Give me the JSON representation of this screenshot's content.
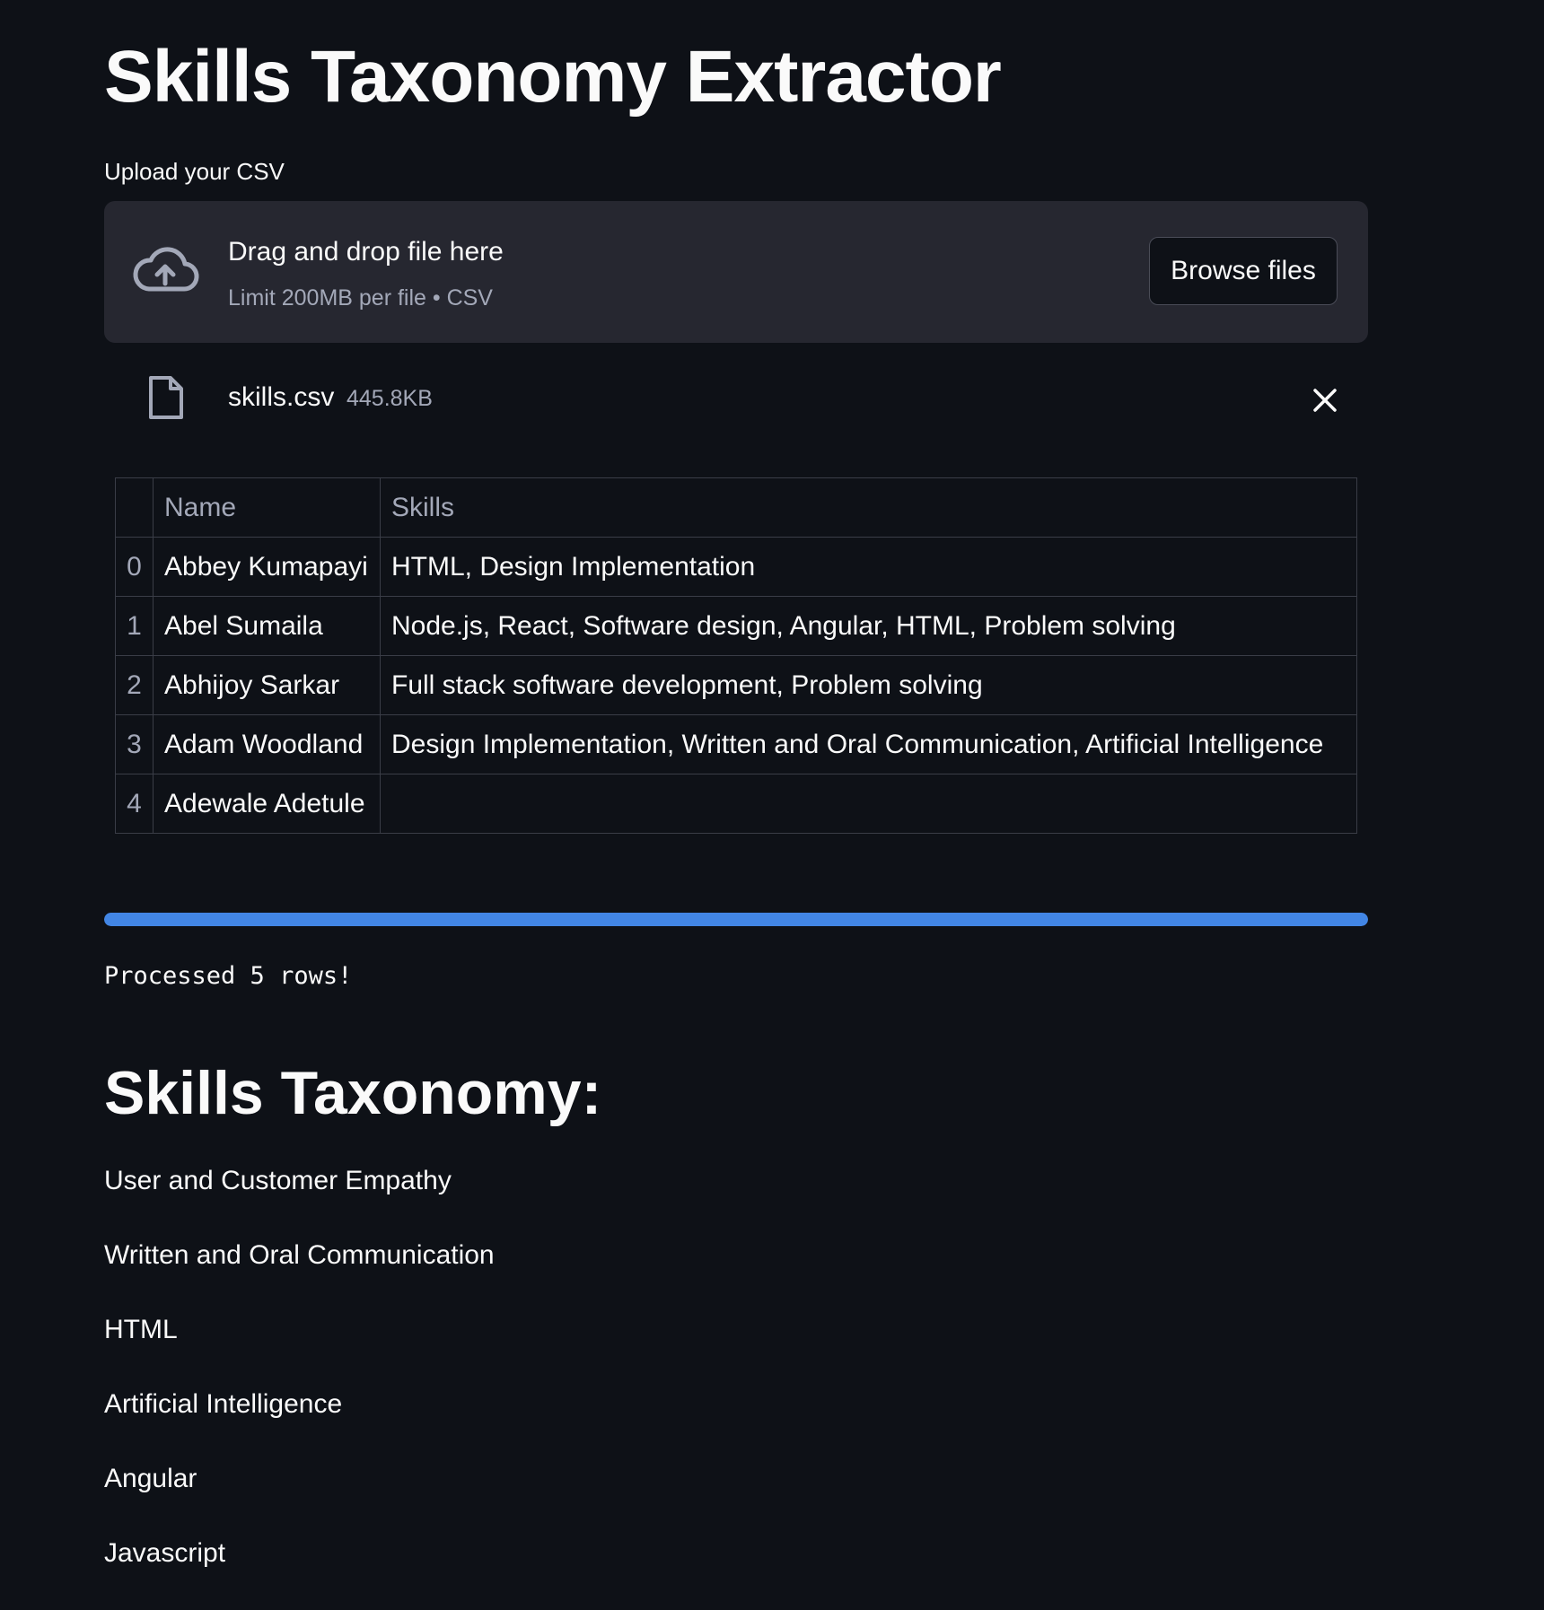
{
  "page": {
    "title": "Skills Taxonomy Extractor"
  },
  "uploader": {
    "label": "Upload your CSV",
    "drop_title": "Drag and drop file here",
    "limit_text": "Limit 200MB per file • CSV",
    "browse_label": "Browse files",
    "icon": "cloud-upload-icon"
  },
  "uploaded_file": {
    "name": "skills.csv",
    "size": "445.8KB",
    "icon": "file-icon"
  },
  "table": {
    "columns": [
      "",
      "Name",
      "Skills"
    ],
    "rows": [
      {
        "index": "0",
        "name": "Abbey Kumapayi",
        "skills": "HTML, Design Implementation"
      },
      {
        "index": "1",
        "name": "Abel Sumaila",
        "skills": "Node.js, React, Software design, Angular, HTML, Problem solving"
      },
      {
        "index": "2",
        "name": "Abhijoy Sarkar",
        "skills": "Full stack software development, Problem solving"
      },
      {
        "index": "3",
        "name": "Adam Woodland",
        "skills": "Design Implementation, Written and Oral Communication, Artificial Intelligence"
      },
      {
        "index": "4",
        "name": "Adewale Adetule",
        "skills": ""
      }
    ]
  },
  "progress": {
    "value": 1.0,
    "color": "#4286e5"
  },
  "status": {
    "text": "Processed 5 rows!"
  },
  "taxonomy": {
    "heading": "Skills Taxonomy:",
    "items": [
      "User and Customer Empathy",
      "Written and Oral Communication",
      "HTML",
      "Artificial Intelligence",
      "Angular",
      "Javascript"
    ]
  },
  "colors": {
    "background": "#0e1117",
    "panel": "#262730",
    "text": "#fafafa",
    "muted": "#a3a8b8"
  }
}
